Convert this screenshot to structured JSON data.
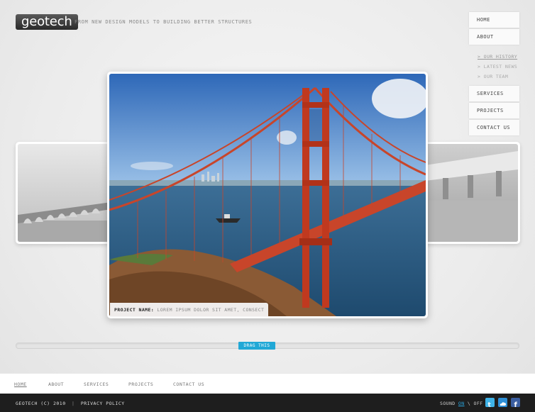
{
  "header": {
    "logo_text": "geotech",
    "tagline": "FROM NEW DESIGN MODELS TO BUILDING BETTER STRUCTURES"
  },
  "nav": {
    "items": [
      {
        "label": "HOME"
      },
      {
        "label": "ABOUT"
      },
      {
        "label": "SERVICES"
      },
      {
        "label": "PROJECTS"
      },
      {
        "label": "CONTACT US"
      }
    ],
    "subnav": [
      {
        "label": "> OUR HISTORY"
      },
      {
        "label": "> LATEST NEWS"
      },
      {
        "label": "> OUR TEAM"
      }
    ]
  },
  "gallery": {
    "caption_label": "PROJECT NAME:",
    "caption_value": "LOREM IPSUM DOLOR SIT AMET, CONSECT",
    "slider_label": "DRAG THIS"
  },
  "footer_nav": {
    "items": [
      {
        "label": "HOME"
      },
      {
        "label": "ABOUT"
      },
      {
        "label": "SERVICES"
      },
      {
        "label": "PROJECTS"
      },
      {
        "label": "CONTACT US"
      }
    ]
  },
  "footer_bar": {
    "copyright": "GEOTECH (C) 2010",
    "separator": "|",
    "privacy": "PRIVACY POLICY",
    "sound_label": "SOUND",
    "sound_on": "ON",
    "sound_sep": "\\",
    "sound_off": "OFF"
  },
  "icons": {
    "twitter": "twitter-icon",
    "cloud": "cloud-icon",
    "facebook": "facebook-icon"
  },
  "colors": {
    "accent": "#21a8d6",
    "bridge_red": "#c8452a",
    "footer_bg": "#1e1e1e"
  }
}
